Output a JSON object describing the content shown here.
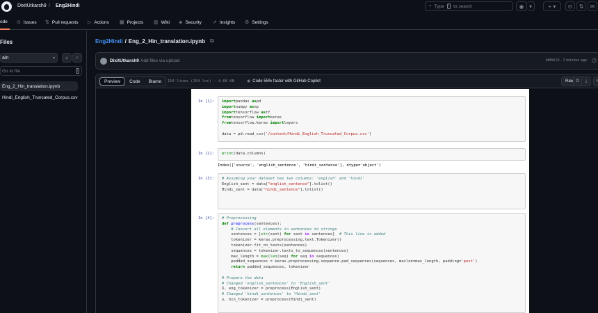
{
  "header": {
    "owner": "DixitUtkarsh9",
    "separator": "/",
    "repo": "Eng2Hindi",
    "search_placeholder_pre": "Type",
    "search_key": "/",
    "search_placeholder_post": "to search"
  },
  "repo_nav": [
    {
      "icon": "<>",
      "label": "ode"
    },
    {
      "icon": "⊙",
      "label": "Issues"
    },
    {
      "icon": "⇅",
      "label": "Pull requests"
    },
    {
      "icon": "▷",
      "label": "Actions"
    },
    {
      "icon": "▦",
      "label": "Projects"
    },
    {
      "icon": "▥",
      "label": "Wiki"
    },
    {
      "icon": "◈",
      "label": "Security"
    },
    {
      "icon": "↗",
      "label": "Insights"
    },
    {
      "icon": "⚙",
      "label": "Settings"
    }
  ],
  "sidebar": {
    "title": "Files",
    "branch": "ain",
    "goto_placeholder": "Go to file",
    "goto_key": "t",
    "files": [
      "Eng_2_Hin_translation.ipynb",
      "Hindi_English_Truncated_Corpus.csv"
    ]
  },
  "path": {
    "repo": "Eng2Hindi",
    "sep": "/",
    "file": "Eng_2_Hin_translation.ipynb"
  },
  "commit": {
    "author": "DixitUtkarsh9",
    "message": "Add files via upload",
    "meta": "bf8b519 · 2 minutes ago"
  },
  "toolbar": {
    "tabs": [
      "Preview",
      "Code",
      "Blame"
    ],
    "active_tab": "Preview",
    "lines_info": "154 lines (154 loc) · 4.68 KB",
    "copilot": "Code 55% faster with GitHub Copilot",
    "raw": "Raw"
  },
  "notebook": {
    "cells": [
      {
        "prompt": "In [1]:",
        "lines": [
          [
            [
              "kw",
              "import"
            ],
            [
              "",
              "pandas "
            ],
            [
              "kw",
              "as"
            ],
            [
              "",
              "pd"
            ]
          ],
          [
            [
              "kw",
              "import"
            ],
            [
              "",
              "numpy "
            ],
            [
              "kw",
              "as"
            ],
            [
              "",
              "np"
            ]
          ],
          [
            [
              "kw",
              "import"
            ],
            [
              "",
              "tensorflow "
            ],
            [
              "kw",
              "as"
            ],
            [
              "",
              "tf"
            ]
          ],
          [
            [
              "kw",
              "from"
            ],
            [
              "",
              "tensorflow "
            ],
            [
              "kw",
              "import"
            ],
            [
              "",
              "keras"
            ]
          ],
          [
            [
              "kw",
              "from"
            ],
            [
              "",
              "tensorflow.keras "
            ],
            [
              "kw",
              "import"
            ],
            [
              "",
              "layers"
            ]
          ],
          [],
          [
            [
              "",
              "data = pd.read_csv("
            ],
            [
              "st",
              "'/content/Hindi_English_Truncated_Corpus.csv'"
            ],
            [
              "",
              ")"
            ]
          ]
        ]
      },
      {
        "prompt": "In [2]:",
        "lines": [
          [
            [
              "bi",
              "print"
            ],
            [
              "",
              "(data.columns)"
            ]
          ]
        ],
        "output": "Index(['source', 'english_sentence', 'hindi_sentence'], dtype='object')"
      },
      {
        "prompt": "In [3]:",
        "lines": [
          [
            [
              "cm",
              "# Assuming your dataset has two columns: 'english' and 'hindi'"
            ]
          ],
          [
            [
              "",
              "English_sent = data["
            ],
            [
              "st",
              "\"english_sentence\""
            ],
            [
              "",
              "].tolist()"
            ]
          ],
          [
            [
              "",
              "Hindi_sent = data["
            ],
            [
              "st",
              "\"hindi_sentence\""
            ],
            [
              "",
              "].tolist()"
            ]
          ]
        ]
      },
      {
        "prompt": "In [4]:",
        "lines": [
          [
            [
              "cm",
              "# Preprocessing"
            ]
          ],
          [
            [
              "kw",
              "def"
            ],
            [
              "fn",
              " preprocess"
            ],
            [
              "",
              "(sentences):"
            ]
          ],
          [
            [
              "cm",
              "    # Convert all elements in sentences to strings"
            ]
          ],
          [
            [
              "",
              "    sentences = ["
            ],
            [
              "bi",
              "str"
            ],
            [
              "",
              "(sent) "
            ],
            [
              "kw",
              "for"
            ],
            [
              "",
              "",
              " "
            ],
            [
              "",
              "sent "
            ],
            [
              "op",
              "in"
            ],
            [
              "",
              "",
              " "
            ],
            [
              "",
              "sentences]  "
            ],
            [
              "cm",
              "# This line is added"
            ]
          ],
          [
            [
              "",
              "    tokenizer = keras.preprocessing.text.Tokenizer()"
            ]
          ],
          [
            [
              "",
              "    tokenizer.fit_on_texts(sentences)"
            ]
          ],
          [
            [
              "",
              "    sequences = tokenizer.texts_to_sequences(sentences)"
            ]
          ],
          [
            [
              "",
              "    max_length = "
            ],
            [
              "bi",
              "max"
            ],
            [
              "",
              "("
            ],
            [
              "bi",
              "len"
            ],
            [
              "",
              "(seq) "
            ],
            [
              "kw",
              "for"
            ],
            [
              "",
              "",
              " "
            ],
            [
              "",
              "seq "
            ],
            [
              "op",
              "in"
            ],
            [
              "",
              "",
              " "
            ],
            [
              "",
              "sequences)"
            ]
          ],
          [
            [
              "",
              "    padded_sequences = keras.preprocessing.sequence.pad_sequences(sequences, maxlen=max_length, padding="
            ],
            [
              "st",
              "'post'"
            ],
            [
              "",
              ")"
            ]
          ],
          [
            [
              "",
              "    "
            ],
            [
              "kw",
              "return"
            ],
            [
              "",
              "",
              " "
            ],
            [
              "",
              "padded_sequences, tokenizer"
            ]
          ],
          [],
          [
            [
              "cm",
              "# Prepare the data"
            ]
          ],
          [
            [
              "cm",
              "# Changed 'english_sentences' to 'English_sent'"
            ]
          ],
          [
            [
              "",
              "X, eng_tokenizer = preprocess(English_sent)"
            ]
          ],
          [
            [
              "cm",
              "# Changed 'hindi_sentences' to 'Hindi_sent'"
            ]
          ],
          [
            [
              "",
              "y, hin_tokenizer = preprocess(Hindi_sent)"
            ]
          ]
        ]
      }
    ]
  }
}
